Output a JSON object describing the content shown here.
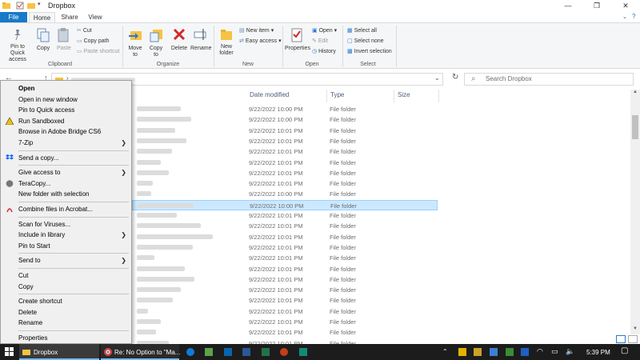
{
  "window": {
    "title": "Dropbox",
    "minimize": "—",
    "maximize": "❐",
    "close": "✕"
  },
  "tabs": {
    "file": "File",
    "home": "Home",
    "share": "Share",
    "view": "View"
  },
  "ribbon": {
    "clipboard": {
      "pin": "Pin to Quick access",
      "copy": "Copy",
      "paste": "Paste",
      "cut": "Cut",
      "copy_path": "Copy path",
      "paste_shortcut": "Paste shortcut",
      "group": "Clipboard"
    },
    "organize": {
      "move_to": "Move to",
      "copy_to": "Copy to",
      "delete": "Delete",
      "rename": "Rename",
      "group": "Organize"
    },
    "new": {
      "new_folder": "New folder",
      "new_item": "New item",
      "easy_access": "Easy access",
      "group": "New"
    },
    "open": {
      "properties": "Properties",
      "open": "Open",
      "edit": "Edit",
      "history": "History",
      "group": "Open"
    },
    "select": {
      "select_all": "Select all",
      "select_none": "Select none",
      "invert": "Invert selection",
      "group": "Select"
    }
  },
  "search": {
    "placeholder": "Search Dropbox"
  },
  "columns": {
    "date": "Date modified",
    "type": "Type",
    "size": "Size"
  },
  "rows": [
    {
      "date": "9/22/2022 10:00 PM",
      "type": "File folder"
    },
    {
      "date": "9/22/2022 10:00 PM",
      "type": "File folder"
    },
    {
      "date": "9/22/2022 10:01 PM",
      "type": "File folder"
    },
    {
      "date": "9/22/2022 10:01 PM",
      "type": "File folder"
    },
    {
      "date": "9/22/2022 10:01 PM",
      "type": "File folder"
    },
    {
      "date": "9/22/2022 10:01 PM",
      "type": "File folder"
    },
    {
      "date": "9/22/2022 10:01 PM",
      "type": "File folder"
    },
    {
      "date": "9/22/2022 10:01 PM",
      "type": "File folder"
    },
    {
      "date": "9/22/2022 10:00 PM",
      "type": "File folder"
    },
    {
      "date": "9/22/2022 10:00 PM",
      "type": "File folder"
    },
    {
      "date": "9/22/2022 10:01 PM",
      "type": "File folder"
    },
    {
      "date": "9/22/2022 10:01 PM",
      "type": "File folder"
    },
    {
      "date": "9/22/2022 10:01 PM",
      "type": "File folder"
    },
    {
      "date": "9/22/2022 10:01 PM",
      "type": "File folder"
    },
    {
      "date": "9/22/2022 10:01 PM",
      "type": "File folder"
    },
    {
      "date": "9/22/2022 10:01 PM",
      "type": "File folder"
    },
    {
      "date": "9/22/2022 10:01 PM",
      "type": "File folder"
    },
    {
      "date": "9/22/2022 10:01 PM",
      "type": "File folder"
    },
    {
      "date": "9/22/2022 10:01 PM",
      "type": "File folder"
    },
    {
      "date": "9/22/2022 10:01 PM",
      "type": "File folder"
    },
    {
      "date": "9/22/2022 10:01 PM",
      "type": "File folder"
    },
    {
      "date": "9/22/2022 10:01 PM",
      "type": "File folder"
    },
    {
      "date": "9/22/2022 10:01 PM",
      "type": "File folder"
    }
  ],
  "selected_row": 9,
  "context_menu": [
    {
      "label": "Open",
      "bold": true
    },
    {
      "label": "Open in new window"
    },
    {
      "label": "Pin to Quick access"
    },
    {
      "label": "Run Sandboxed",
      "icon": "sandboxie-icon"
    },
    {
      "label": "Browse in Adobe Bridge CS6"
    },
    {
      "label": "7-Zip",
      "submenu": true
    },
    {
      "sep": true
    },
    {
      "label": "Send a copy...",
      "icon": "dropbox-icon"
    },
    {
      "sep": true
    },
    {
      "label": "Give access to",
      "submenu": true
    },
    {
      "label": "TeraCopy...",
      "icon": "teracopy-icon"
    },
    {
      "label": "New folder with selection"
    },
    {
      "sep": true
    },
    {
      "label": "Combine files in Acrobat...",
      "icon": "acrobat-icon"
    },
    {
      "sep": true
    },
    {
      "label": "Scan for Viruses..."
    },
    {
      "label": "Include in library",
      "submenu": true
    },
    {
      "label": "Pin to Start"
    },
    {
      "sep": true
    },
    {
      "label": "Send to",
      "submenu": true
    },
    {
      "sep": true
    },
    {
      "label": "Cut"
    },
    {
      "label": "Copy"
    },
    {
      "sep": true
    },
    {
      "label": "Create shortcut"
    },
    {
      "label": "Delete"
    },
    {
      "label": "Rename"
    },
    {
      "sep": true
    },
    {
      "label": "Properties"
    }
  ],
  "taskbar": {
    "explorer_label": "Dropbox",
    "chrome_label": "Re: No Option to \"Ma...",
    "clock": "5:39 PM"
  },
  "colors": {
    "accent": "#1979ca",
    "selection": "#cce8ff",
    "taskbar": "#1c1c1c"
  }
}
